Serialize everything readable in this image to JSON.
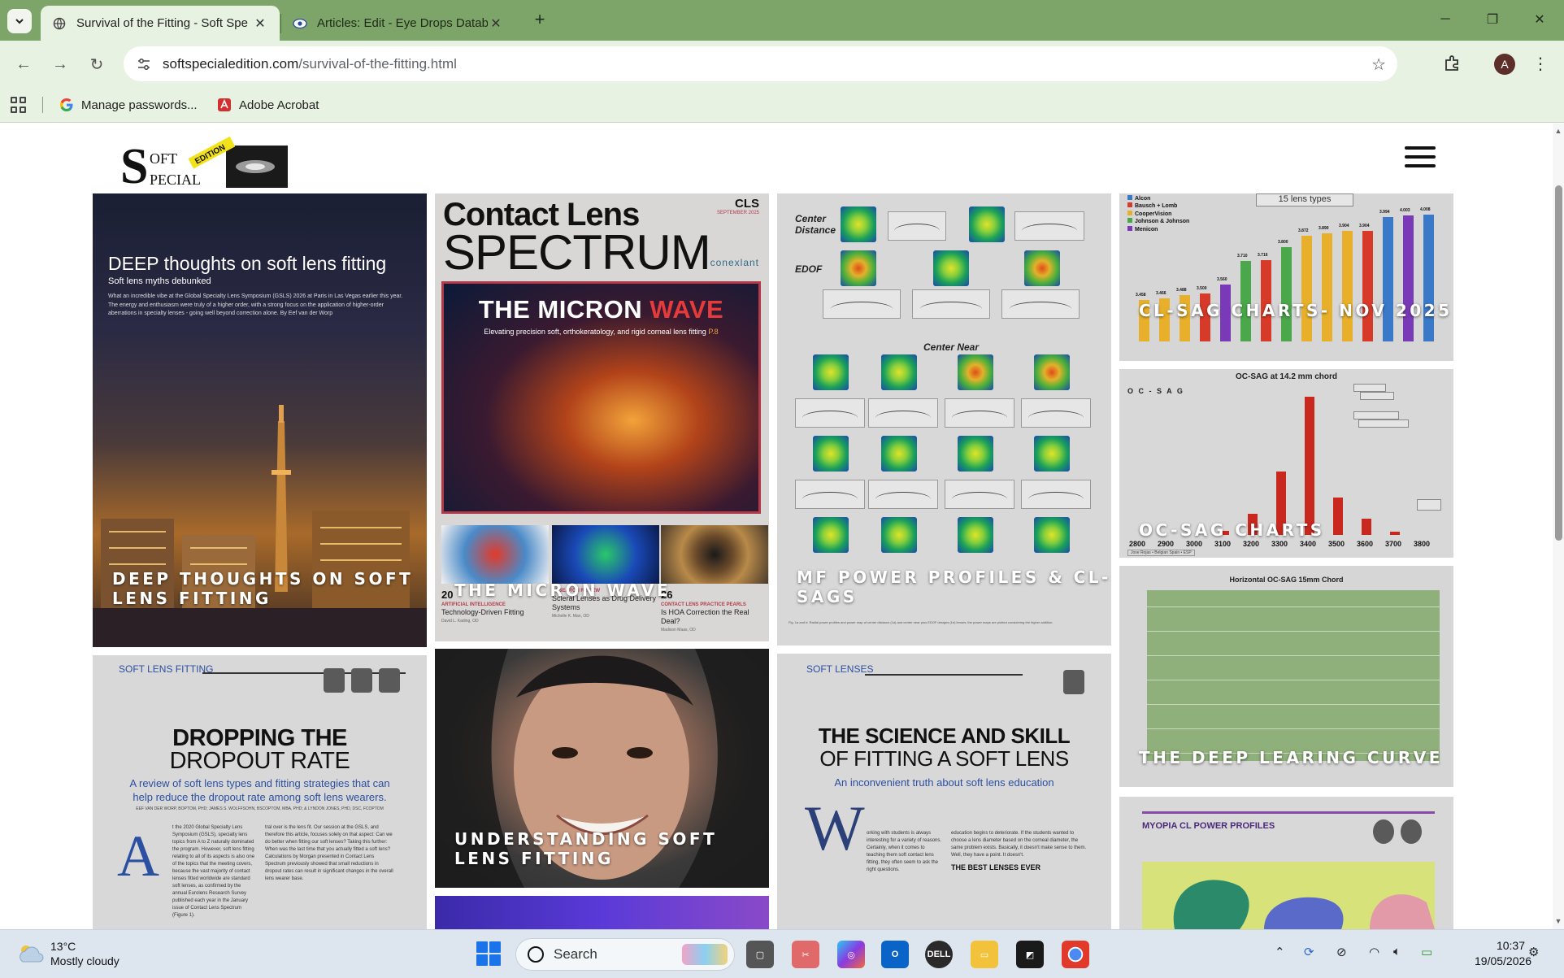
{
  "browser": {
    "tabs": [
      {
        "title": "Survival of the Fitting - Soft Spe",
        "active": true
      },
      {
        "title": "Articles: Edit - Eye Drops Datab",
        "active": false
      }
    ],
    "url_domain": "softspecialedition.com",
    "url_path": "/survival-of-the-fitting.html",
    "avatar_letter": "A",
    "bookmarks": [
      {
        "label": "Manage passwords...",
        "icon": "google-icon"
      },
      {
        "label": "Adobe Acrobat",
        "icon": "acrobat-icon"
      }
    ]
  },
  "site": {
    "logo": {
      "line1": "OFT",
      "line2": "PECIAL",
      "big_letter": "S",
      "ribbon": "EDITION"
    }
  },
  "cards": {
    "deep": {
      "caption": "DEEP THOUGHTS ON SOFT LENS FITTING",
      "heading": "DEEP thoughts on soft lens fitting",
      "sub": "Soft lens myths debunked",
      "body": "What an incredible vibe at the Global Specialty Lens Symposium (GSLS) 2026 at Paris in Las Vegas earlier this year. The energy and enthusiasm were truly of a higher order, with a strong focus on the application of higher-order aberrations in specialty lenses - going well beyond correction alone. By Eef van der Worp"
    },
    "micron": {
      "caption": "THE MICRON WAVE",
      "masthead1": "Contact Lens",
      "masthead2": "SPECTRUM",
      "cls": "CLS",
      "issue": "SEPTEMBER 2025",
      "brand": "conexlant",
      "cover_title_a": "THE MICRON ",
      "cover_title_b": "WAVE",
      "cover_sub": "Elevating precision soft, orthokeratology, and rigid corneal lens fitting",
      "cover_page": "P.8",
      "toc": [
        {
          "num": "20",
          "kicker": "ARTIFICIAL INTELLIGENCE",
          "title": "Technology-Driven Fitting",
          "author": "David L. Kading, OD"
        },
        {
          "num": "",
          "kicker": "RESEARCH REVIEW",
          "title": "Scleral Lenses as Drug Delivery Systems",
          "author": "Michelle K. Man, OD"
        },
        {
          "num": "26",
          "kicker": "CONTACT LENS PRACTICE PEARLS",
          "title": "Is HOA Correction the Real Deal?",
          "author": "Madison Maas, OD"
        }
      ]
    },
    "mf": {
      "caption": "MF POWER PROFILES & CL-SAGS",
      "label_center_distance": "Center Distance",
      "label_edof": "EDOF",
      "label_center_near": "Center Near",
      "footnote": "Fig. 1a and b: Radial power profiles and power map of center distance (1a) and center near plus EDOF designs (1b) lenses; the power maps are plotted considering the higher addition."
    },
    "clsag": {
      "caption": "CL-SAG CHARTS- NOV 2025",
      "legend": [
        "Alcon",
        "Bausch + Lomb",
        "CooperVision",
        "Johnson & Johnson",
        "Menicon"
      ],
      "legend_colors": [
        "#3a78c8",
        "#d83a2a",
        "#e8b02a",
        "#4aa84a",
        "#7a3ab8"
      ],
      "label": "15 lens types",
      "bar_values": [
        "3.458",
        "3.466",
        "3.488",
        "3.500",
        "3.560",
        "3.710",
        "3.716",
        "3.800",
        "3.872",
        "3.890",
        "3.904",
        "3.904",
        "3.994",
        "4.003",
        "4.008"
      ],
      "bar_colors": [
        "#e8b02a",
        "#e8b02a",
        "#e8b02a",
        "#d83a2a",
        "#7a3ab8",
        "#4aa84a",
        "#d83a2a",
        "#4aa84a",
        "#e8b02a",
        "#e8b02a",
        "#e8b02a",
        "#d83a2a",
        "#3a78c8",
        "#7a3ab8",
        "#3a78c8"
      ]
    },
    "ocsag": {
      "caption": "OC-SAG CHARTS",
      "title": "OC-SAG at 14.2 mm chord",
      "brand": "O C - S A G",
      "x_labels": [
        "2800",
        "2900",
        "3000",
        "3100",
        "3200",
        "3300",
        "3400",
        "3500",
        "3600",
        "3700",
        "3800"
      ],
      "bars": [
        0,
        0,
        0,
        8,
        40,
        120,
        260,
        70,
        30,
        6,
        0
      ],
      "source": "Jose Rojas • Belgian Spain • ESP"
    },
    "deep_curve": {
      "caption": "THE DEEP LEARING CURVE",
      "title": "Horizontal OC-SAG 15mm Chord"
    },
    "dropout": {
      "kicker": "SOFT LENS FITTING",
      "h1": "DROPPING THE",
      "h2": "DROPOUT RATE",
      "dek": "A review of soft lens types and fitting strategies that can help reduce the dropout rate among soft lens wearers.",
      "byline": "EEF VAN DER WORP, BOPTOM, PHD; JAMES S. WOLFFSOHN, BSCOPTOM, MBA, PHD; & LYNDON JONES, PHD, DSC, FCOPTOM",
      "drop_cap": "A",
      "col1": "t the 2020 Global Specialty Lens Symposium (GSLS), specialty lens topics from A to Z naturally dominated the program. However, soft lens fitting relating to all of its aspects is also one of the topics that the meeting covers, because the vast majority of contact lenses fitted worldwide are standard soft lenses, as confirmed by the annual Eurolens Research Survey published each year in the January issue of Contact Lens Spectrum (Figure 1).",
      "col2": "tral over is the lens fit. Our session at the GSLS, and therefore this article, focuses solely on that aspect: Can we do better when fitting our soft lenses? Taking this further: When was the last time that you actually fitted a soft lens? Calculations by Morgan presented in Contact Lens Spectrum previously showed that small reductions in dropout rates can result in significant changes in the overall lens wearer base."
    },
    "understanding": {
      "caption": "UNDERSTANDING SOFT LENS FITTING"
    },
    "science": {
      "kicker": "SOFT LENSES",
      "h1": "THE SCIENCE AND SKILL",
      "h2": "OF FITTING A SOFT LENS",
      "dek": "An inconvenient truth about soft lens education",
      "drop_cap": "W",
      "col1": "orking with students is always interesting for a variety of reasons. Certainly, when it comes to teaching them soft contact lens fitting, they often seem to ask the right questions.",
      "col2": "education begins to deteriorate. If the students wanted to choose a lens diameter based on the corneal diameter, the same problem exists. Basically, it doesn't make sense to them. Well, they have a point. It doesn't.",
      "best": "THE BEST LENSES EVER"
    },
    "myopia": {
      "kicker": "MYOPIA CL POWER PROFILES"
    }
  },
  "taskbar": {
    "temp": "13°C",
    "weather": "Mostly cloudy",
    "search_placeholder": "Search",
    "time": "10:37",
    "date": "19/05/2026"
  }
}
